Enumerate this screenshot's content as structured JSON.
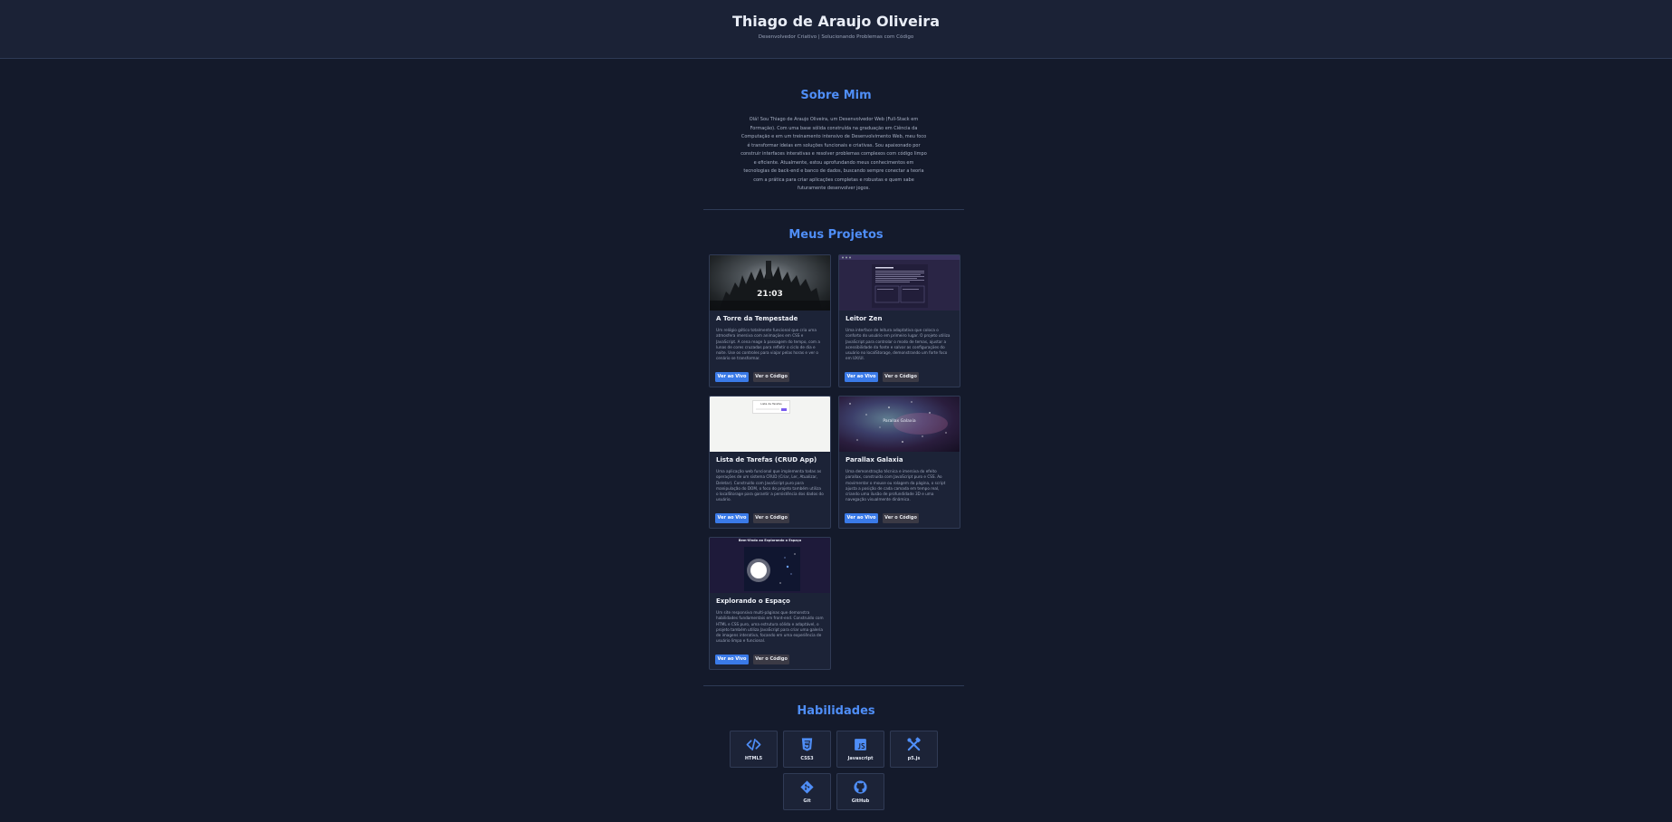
{
  "header": {
    "name": "Thiago de Araujo Oliveira",
    "tagline": "Desenvolvedor Criativo | Solucionando Problemas com Código"
  },
  "about": {
    "title": "Sobre Mim",
    "text": "Olá! Sou Thiago de Araujo Oliveira, um Desenvolvedor Web (Full-Stack em Formação). Com uma base sólida construída na graduação em Ciência da Computação e em um treinamento intensivo de Desenvolvimento Web, meu foco é transformar ideias em soluções funcionais e criativas. Sou apaixonado por construir interfaces interativas e resolver problemas complexos com código limpo e eficiente. Atualmente, estou aprofundando meus conhecimentos em tecnologias de back-end e banco de dados, buscando sempre conectar a teoria com a prática para criar aplicações completas e robustas e quem sabe futuramente desenvolver jogos."
  },
  "projects": {
    "title": "Meus Projetos",
    "live_label": "Ver ao Vivo",
    "code_label": "Ver o Código",
    "items": [
      {
        "title": "A Torre da Tempestade",
        "description": "Um relógio gótico totalmente funcional que cria uma atmosfera imersiva com animações em CSS e JavaScript. A cena reage à passagem do tempo, com a lunas de cores cruzadas para refletir o ciclo de dia e noite. Use os controles para viajar pelas horas e ver o cenário se transformar.",
        "thumb_text": "21:03"
      },
      {
        "title": "Leitor Zen",
        "description": "Uma interface de leitura adaptativa que coloca o conforto do usuário em primeiro lugar. O projeto utiliza JavaScript para controlar o modo de temas, ajustar a acessibilidade da fonte e salvar as configurações do usuário no localStorage, demonstrando um forte foco em UX/UI."
      },
      {
        "title": "Lista de Tarefas (CRUD App)",
        "description": "Uma aplicação web funcional que implementa todas as operações de um sistema CRUD (Criar, Ler, Atualizar, Deletar). Construído com JavaScript puro para manipulação do DOM, o foco do projeto também utiliza o localStorage para garantir a persistência dos dados do usuário.",
        "thumb_text": "Lista de Tarefas"
      },
      {
        "title": "Parallax Galaxia",
        "description": "Uma demonstração técnica e imersiva do efeito parallax, construída com JavaScript puro e CSS. Ao movimentar o mouse ou rolagem da página, o script ajusta a posição de cada camada em tempo real, criando uma ilusão de profundidade 3D e uma navegação visualmente dinâmica.",
        "thumb_text": "Parallax Galaxia"
      },
      {
        "title": "Explorando o Espaço",
        "description": "Um site responsivo multi-páginas que demonstra habilidades fundamentais em front-end. Construído com HTML e CSS puro, uma estrutura sólida e adaptável, o projeto também utiliza JavaScript para criar uma galeria de imagens interativa, focando em uma experiência de usuário limpa e funcional.",
        "thumb_text": "Bem-Vindo ao Explorando o Espaço"
      }
    ]
  },
  "skills": {
    "title": "Habilidades",
    "items": [
      {
        "label": "HTML5",
        "icon": "code-icon"
      },
      {
        "label": "CSS3",
        "icon": "css3-icon"
      },
      {
        "label": "Javascript",
        "icon": "js-icon"
      },
      {
        "label": "p5.js",
        "icon": "tools-icon"
      },
      {
        "label": "Git",
        "icon": "git-icon"
      },
      {
        "label": "GitHub",
        "icon": "github-icon"
      }
    ]
  },
  "colors": {
    "accent": "#4f8ef7",
    "background": "#141a2b",
    "card": "#1c2337"
  }
}
